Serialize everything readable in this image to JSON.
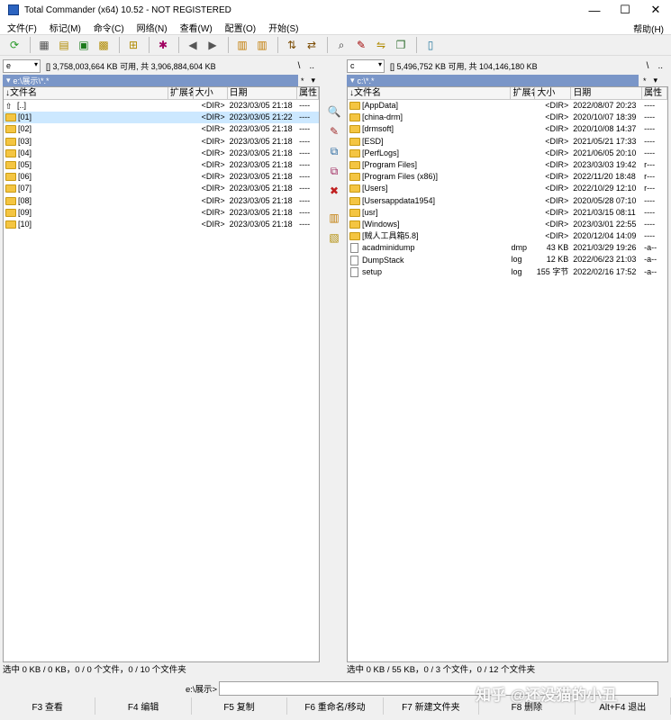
{
  "window": {
    "title": "Total Commander (x64) 10.52 - NOT REGISTERED"
  },
  "menu": [
    "文件(F)",
    "标记(M)",
    "命令(C)",
    "网络(N)",
    "查看(W)",
    "配置(O)",
    "开始(S)"
  ],
  "menu_help": "帮助(H)",
  "left": {
    "drive": "e",
    "drive_info": "[] 3,758,003,664 KB 可用, 共 3,906,884,604 KB",
    "path": "e:\\展示\\*.*",
    "headers": {
      "name": "文件名",
      "ext": "扩展名",
      "size": "大小",
      "date": "日期",
      "attr": "属性"
    },
    "rows": [
      {
        "name": "[..]",
        "ext": "",
        "size": "<DIR>",
        "date": "2023/03/05 21:18",
        "attr": "----"
      },
      {
        "name": "[01]",
        "ext": "",
        "size": "<DIR>",
        "date": "2023/03/05 21:22",
        "attr": "----"
      },
      {
        "name": "[02]",
        "ext": "",
        "size": "<DIR>",
        "date": "2023/03/05 21:18",
        "attr": "----"
      },
      {
        "name": "[03]",
        "ext": "",
        "size": "<DIR>",
        "date": "2023/03/05 21:18",
        "attr": "----"
      },
      {
        "name": "[04]",
        "ext": "",
        "size": "<DIR>",
        "date": "2023/03/05 21:18",
        "attr": "----"
      },
      {
        "name": "[05]",
        "ext": "",
        "size": "<DIR>",
        "date": "2023/03/05 21:18",
        "attr": "----"
      },
      {
        "name": "[06]",
        "ext": "",
        "size": "<DIR>",
        "date": "2023/03/05 21:18",
        "attr": "----"
      },
      {
        "name": "[07]",
        "ext": "",
        "size": "<DIR>",
        "date": "2023/03/05 21:18",
        "attr": "----"
      },
      {
        "name": "[08]",
        "ext": "",
        "size": "<DIR>",
        "date": "2023/03/05 21:18",
        "attr": "----"
      },
      {
        "name": "[09]",
        "ext": "",
        "size": "<DIR>",
        "date": "2023/03/05 21:18",
        "attr": "----"
      },
      {
        "name": "[10]",
        "ext": "",
        "size": "<DIR>",
        "date": "2023/03/05 21:18",
        "attr": "----"
      }
    ],
    "status": "选中 0 KB / 0 KB，0 / 0 个文件，0 / 10 个文件夹"
  },
  "right": {
    "drive": "c",
    "drive_info": "[] 5,496,752 KB 可用, 共 104,146,180 KB",
    "path": "c:\\*.*",
    "headers": {
      "name": "文件名",
      "ext": "扩展名",
      "size": "大小",
      "date": "日期",
      "attr": "属性"
    },
    "rows": [
      {
        "name": "[AppData]",
        "ext": "",
        "size": "<DIR>",
        "date": "2022/08/07 20:23",
        "attr": "----"
      },
      {
        "name": "[china-drm]",
        "ext": "",
        "size": "<DIR>",
        "date": "2020/10/07 18:39",
        "attr": "----"
      },
      {
        "name": "[drmsoft]",
        "ext": "",
        "size": "<DIR>",
        "date": "2020/10/08 14:37",
        "attr": "----"
      },
      {
        "name": "[ESD]",
        "ext": "",
        "size": "<DIR>",
        "date": "2021/05/21 17:33",
        "attr": "----"
      },
      {
        "name": "[PerfLogs]",
        "ext": "",
        "size": "<DIR>",
        "date": "2021/06/05 20:10",
        "attr": "----"
      },
      {
        "name": "[Program Files]",
        "ext": "",
        "size": "<DIR>",
        "date": "2023/03/03 19:42",
        "attr": "r---"
      },
      {
        "name": "[Program Files (x86)]",
        "ext": "",
        "size": "<DIR>",
        "date": "2022/11/20 18:48",
        "attr": "r---"
      },
      {
        "name": "[Users]",
        "ext": "",
        "size": "<DIR>",
        "date": "2022/10/29 12:10",
        "attr": "r---"
      },
      {
        "name": "[Usersappdata1954]",
        "ext": "",
        "size": "<DIR>",
        "date": "2020/05/28 07:10",
        "attr": "----"
      },
      {
        "name": "[usr]",
        "ext": "",
        "size": "<DIR>",
        "date": "2021/03/15 08:11",
        "attr": "----"
      },
      {
        "name": "[Windows]",
        "ext": "",
        "size": "<DIR>",
        "date": "2023/03/01 22:55",
        "attr": "----"
      },
      {
        "name": "[贼人工具箱5.8]",
        "ext": "",
        "size": "<DIR>",
        "date": "2020/12/04 14:09",
        "attr": "----"
      },
      {
        "name": "acadminidump",
        "ext": "dmp",
        "size": "43 KB",
        "date": "2021/03/29 19:26",
        "attr": "-a--"
      },
      {
        "name": "DumpStack",
        "ext": "log",
        "size": "12 KB",
        "date": "2022/06/23 21:03",
        "attr": "-a--"
      },
      {
        "name": "setup",
        "ext": "log",
        "size": "155 字节",
        "date": "2022/02/16 17:52",
        "attr": "-a--"
      }
    ],
    "status": "选中 0 KB / 55 KB，0 / 3 个文件，0 / 12 个文件夹"
  },
  "nav": {
    "root": "\\",
    "parent": "..",
    "star": "*",
    "down": "▾"
  },
  "cmdline": {
    "prompt": "e:\\展示>"
  },
  "fkeys": [
    "F3 查看",
    "F4 编辑",
    "F5 复制",
    "F6 重命名/移动",
    "F7 新建文件夹",
    "F8 删除",
    "Alt+F4 退出"
  ],
  "watermark": "知乎 @还没猫的小丑"
}
